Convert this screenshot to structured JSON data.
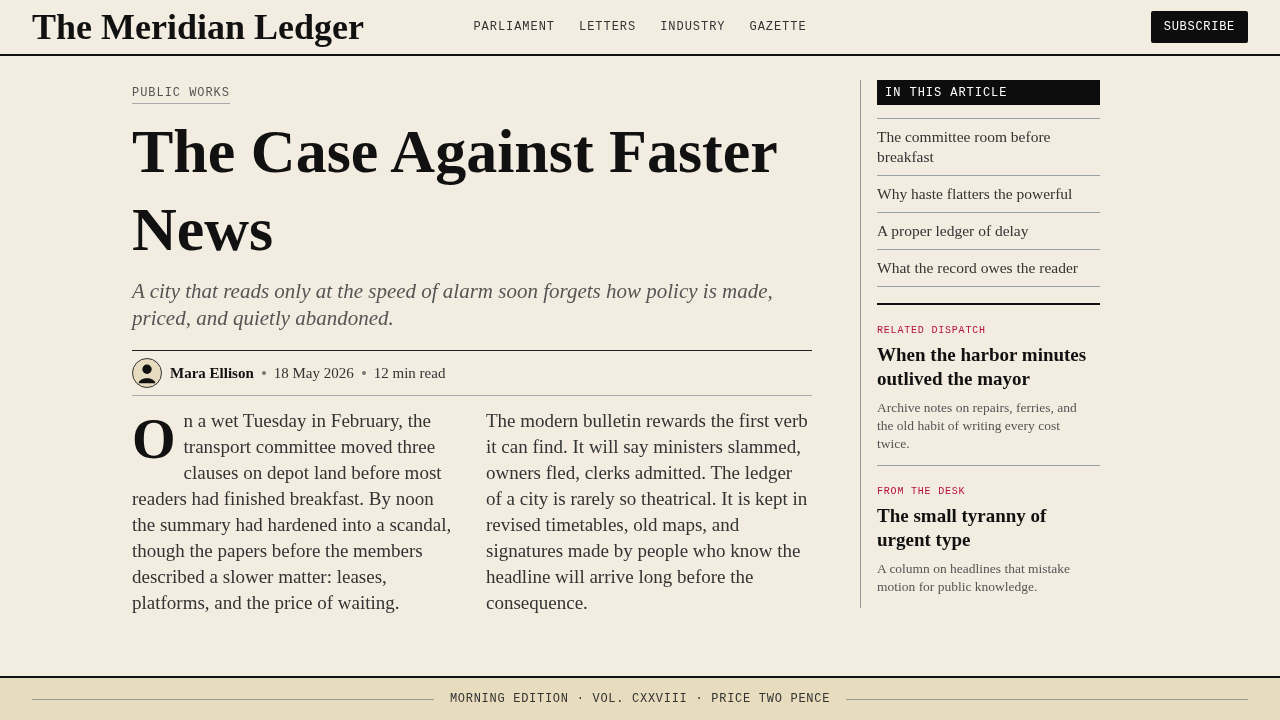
{
  "header": {
    "logo": "The Meridian Ledger",
    "nav": [
      "PARLIAMENT",
      "LETTERS",
      "INDUSTRY",
      "GAZETTE"
    ],
    "subscribe": "SUBSCRIBE"
  },
  "article": {
    "category": "PUBLIC WORKS",
    "title": "The Case Against Faster News",
    "dek": "A city that reads only at the speed of alarm soon forgets how policy is made, priced, and quietly abandoned.",
    "byline": {
      "author": "Mara Ellison",
      "date": "18 May 2026",
      "read_time": "12 min read"
    },
    "paragraphs": [
      "On a wet Tuesday in February, the transport committee moved three clauses on depot land before most readers had finished breakfast. By noon the summary had hardened into a scandal, though the papers before the members described a slower matter: leases, platforms, and the price of waiting.",
      "The modern bulletin rewards the first verb it can find. It will say ministers slammed, owners fled, clerks admitted. The ledger of a city is rarely so theatrical. It is kept in revised timetables, old maps, and signatures made by people who know the headline will arrive long before the consequence."
    ]
  },
  "sidebar": {
    "contents": {
      "heading": "IN THIS ARTICLE",
      "items": [
        "The committee room before breakfast",
        "Why haste flatters the powerful",
        "A proper ledger of delay",
        "What the record owes the reader"
      ]
    },
    "features": [
      {
        "kicker": "RELATED DISPATCH",
        "headline": "When the harbor minutes outlived the mayor",
        "summary": "Archive notes on repairs, ferries, and the old habit of writing every cost twice."
      },
      {
        "kicker": "FROM THE DESK",
        "headline": "The small tyranny of urgent type",
        "summary": "A column on headlines that mistake motion for public knowledge."
      }
    ]
  },
  "footer": {
    "text": "MORNING EDITION · VOL. CXXVIII · PRICE TWO PENCE"
  }
}
